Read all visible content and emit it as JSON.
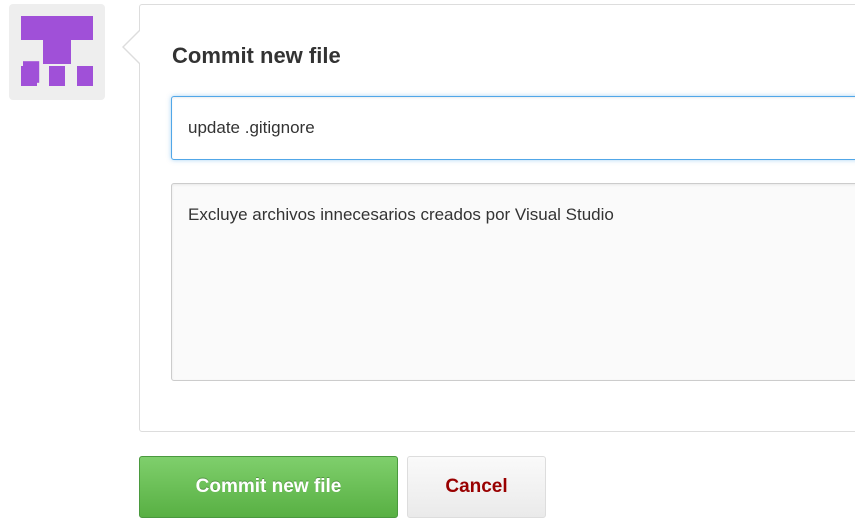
{
  "avatar": {
    "icon": "identicon",
    "color": "#a050d8"
  },
  "commit_form": {
    "title": "Commit new file",
    "summary_value": "update .gitignore",
    "description_value": "Excluye archivos innecesarios creados por Visual Studio"
  },
  "actions": {
    "commit_label": "Commit new file",
    "cancel_label": "Cancel"
  },
  "colors": {
    "commit_button": "#6cc644",
    "cancel_text": "#990000",
    "focus_border": "#51a7e8"
  }
}
